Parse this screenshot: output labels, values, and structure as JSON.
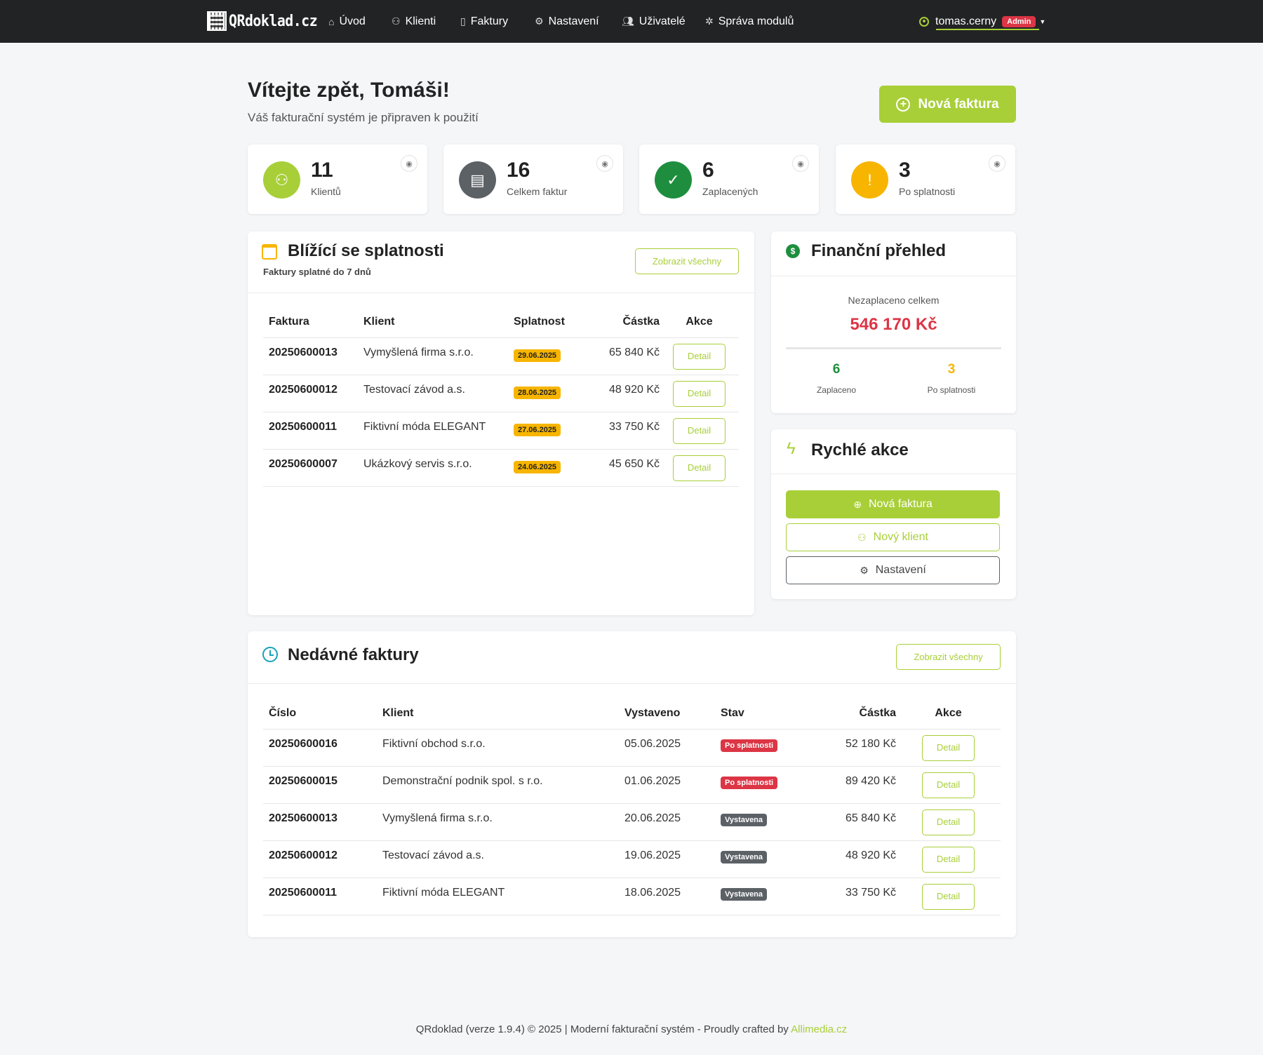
{
  "nav": {
    "brand": "QRdoklad.cz",
    "items": [
      {
        "label": "Úvod",
        "icon": "home-icon"
      },
      {
        "label": "Klienti",
        "icon": "users-icon"
      },
      {
        "label": "Faktury",
        "icon": "document-icon"
      },
      {
        "label": "Nastavení",
        "icon": "gear-icon"
      },
      {
        "label": "Uživatelé",
        "icon": "people-icon"
      },
      {
        "label": "Správa modulů",
        "icon": "cog-icon"
      }
    ],
    "user": {
      "name": "tomas.cerny",
      "role": "Admin"
    }
  },
  "hero": {
    "title": "Vítejte zpět, Tomáši!",
    "subtitle": "Váš fakturační systém je připraven k použití",
    "new_invoice": "Nová faktura"
  },
  "stats": [
    {
      "value": "11",
      "label": "Klientů",
      "color": "#a8cf38",
      "icon": "clients-icon"
    },
    {
      "value": "16",
      "label": "Celkem faktur",
      "color": "#5c6166",
      "icon": "invoice-icon"
    },
    {
      "value": "6",
      "label": "Zaplacených",
      "color": "#1e8e3e",
      "icon": "check-icon"
    },
    {
      "value": "3",
      "label": "Po splatnosti",
      "color": "#f7b500",
      "icon": "warning-icon"
    }
  ],
  "upcoming": {
    "title": "Blížící se splatnosti",
    "subtitle": "Faktury splatné do 7 dnů",
    "show_all": "Zobrazit všechny",
    "columns": [
      "Faktura",
      "Klient",
      "Splatnost",
      "Částka",
      "Akce"
    ],
    "rows": [
      {
        "number": "20250600013",
        "client": "Vymyšlená firma s.r.o.",
        "due": "29.06.2025",
        "amount": "65 840 Kč",
        "action": "Detail"
      },
      {
        "number": "20250600012",
        "client": "Testovací závod a.s.",
        "due": "28.06.2025",
        "amount": "48 920 Kč",
        "action": "Detail"
      },
      {
        "number": "20250600011",
        "client": "Fiktivní móda ELEGANT",
        "due": "27.06.2025",
        "amount": "33 750 Kč",
        "action": "Detail"
      },
      {
        "number": "20250600007",
        "client": "Ukázkový servis s.r.o.",
        "due": "24.06.2025",
        "amount": "45 650 Kč",
        "action": "Detail"
      }
    ]
  },
  "finance": {
    "title": "Finanční přehled",
    "unpaid_label": "Nezaplaceno celkem",
    "unpaid_total": "546 170 Kč",
    "paid_value": "6",
    "paid_label": "Zaplaceno",
    "overdue_value": "3",
    "overdue_label": "Po splatnosti"
  },
  "quick": {
    "title": "Rychlé akce",
    "new_invoice": "Nová faktura",
    "new_client": "Nový klient",
    "settings": "Nastavení"
  },
  "recent": {
    "title": "Nedávné faktury",
    "show_all": "Zobrazit všechny",
    "columns": [
      "Číslo",
      "Klient",
      "Vystaveno",
      "Stav",
      "Částka",
      "Akce"
    ],
    "rows": [
      {
        "number": "20250600016",
        "client": "Fiktivní obchod s.r.o.",
        "issued": "05.06.2025",
        "status": "Po splatnosti",
        "status_type": "over",
        "amount": "52 180 Kč",
        "action": "Detail"
      },
      {
        "number": "20250600015",
        "client": "Demonstrační podnik spol. s r.o.",
        "issued": "01.06.2025",
        "status": "Po splatnosti",
        "status_type": "over",
        "amount": "89 420 Kč",
        "action": "Detail"
      },
      {
        "number": "20250600013",
        "client": "Vymyšlená firma s.r.o.",
        "issued": "20.06.2025",
        "status": "Vystavena",
        "status_type": "iss",
        "amount": "65 840 Kč",
        "action": "Detail"
      },
      {
        "number": "20250600012",
        "client": "Testovací závod a.s.",
        "issued": "19.06.2025",
        "status": "Vystavena",
        "status_type": "iss",
        "amount": "48 920 Kč",
        "action": "Detail"
      },
      {
        "number": "20250600011",
        "client": "Fiktivní móda ELEGANT",
        "issued": "18.06.2025",
        "status": "Vystavena",
        "status_type": "iss",
        "amount": "33 750 Kč",
        "action": "Detail"
      }
    ]
  },
  "footer": {
    "text": "QRdoklad (verze 1.9.4) © 2025 | Moderní fakturační systém - Proudly crafted by ",
    "link": "Allimedia.cz"
  }
}
